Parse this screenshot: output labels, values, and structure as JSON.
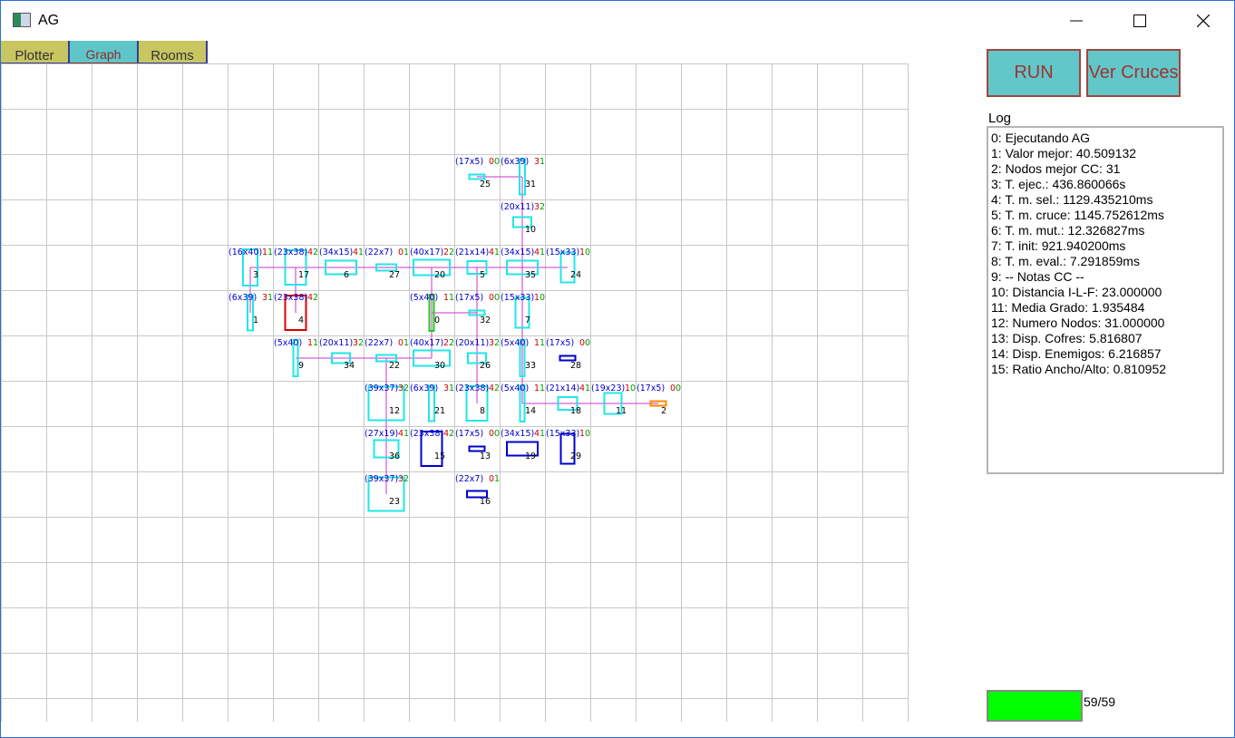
{
  "window": {
    "title": "AG",
    "minimize_icon": "minimize-icon",
    "maximize_icon": "maximize-icon",
    "close_icon": "close-icon"
  },
  "tabs": [
    {
      "label": "Plotter"
    },
    {
      "label": "Graph"
    },
    {
      "label": "Rooms"
    }
  ],
  "active_tab": "Graph",
  "buttons": {
    "run": "RUN",
    "ver_cruces": "Ver Cruces"
  },
  "log": {
    "label": "Log",
    "lines": [
      "0: Ejecutando AG",
      "1: Valor mejor: 40.509132",
      "2: Nodos mejor CC: 31",
      "3: T. ejec.: 436.860066s",
      "4: T. m. sel.: 1129.435210ms",
      "5: T. m. cruce: 1145.752612ms",
      "6: T. m. mut.: 12.326827ms",
      "7: T. init: 921.940200ms",
      "8: T. m. eval.: 7.291859ms",
      "9: -- Notas CC --",
      "10: Distancia I-L-F: 23.000000",
      "11: Media Grado: 1.935484",
      "12: Numero Nodos: 31.000000",
      "13: Disp. Cofres: 5.816807",
      "14: Disp. Enemigos: 6.216857",
      "15: Ratio Ancho/Alto: 0.810952"
    ]
  },
  "progress": {
    "text": "59/59",
    "fraction": 1.0
  },
  "colors": {
    "normal": "#22e6e6",
    "dark": "#0000cc",
    "start": "#22cc22",
    "end": "#ff8800",
    "selected": "#dd0000",
    "edge": "#cc33cc",
    "size_text": "#0000cc",
    "n1": "#cc0000",
    "n2": "#009900"
  },
  "graph": {
    "grid": {
      "cols": 20,
      "rows": 15
    },
    "nodes": [
      {
        "id": "25",
        "size": "(17x5)",
        "a": "0",
        "b": "0",
        "cell": [
          10,
          2
        ],
        "style": "normal"
      },
      {
        "id": "31",
        "size": "(6x39)",
        "a": "3",
        "b": "1",
        "cell": [
          11,
          2
        ],
        "style": "normal"
      },
      {
        "id": "10",
        "size": "(20x11)",
        "a": "3",
        "b": "2",
        "cell": [
          11,
          3
        ],
        "style": "normal"
      },
      {
        "id": "3",
        "size": "(16x40)",
        "a": "1",
        "b": "1",
        "cell": [
          5,
          4
        ],
        "style": "normal"
      },
      {
        "id": "17",
        "size": "(23x38)",
        "a": "4",
        "b": "2",
        "cell": [
          6,
          4
        ],
        "style": "normal"
      },
      {
        "id": "6",
        "size": "(34x15)",
        "a": "4",
        "b": "1",
        "cell": [
          7,
          4
        ],
        "style": "normal"
      },
      {
        "id": "27",
        "size": "(22x7)",
        "a": "0",
        "b": "1",
        "cell": [
          8,
          4
        ],
        "style": "normal"
      },
      {
        "id": "20",
        "size": "(40x17)",
        "a": "2",
        "b": "2",
        "cell": [
          9,
          4
        ],
        "style": "normal"
      },
      {
        "id": "5",
        "size": "(21x14)",
        "a": "4",
        "b": "1",
        "cell": [
          10,
          4
        ],
        "style": "normal"
      },
      {
        "id": "35",
        "size": "(34x15)",
        "a": "4",
        "b": "1",
        "cell": [
          11,
          4
        ],
        "style": "normal"
      },
      {
        "id": "24",
        "size": "(15x33)",
        "a": "1",
        "b": "0",
        "cell": [
          12,
          4
        ],
        "style": "normal"
      },
      {
        "id": "1",
        "size": "(6x39)",
        "a": "3",
        "b": "1",
        "cell": [
          5,
          5
        ],
        "style": "normal"
      },
      {
        "id": "4",
        "size": "(23x38)",
        "a": "4",
        "b": "2",
        "cell": [
          6,
          5
        ],
        "style": "selected"
      },
      {
        "id": "0",
        "size": "(5x40)",
        "a": "1",
        "b": "1",
        "cell": [
          9,
          5
        ],
        "style": "start"
      },
      {
        "id": "32",
        "size": "(17x5)",
        "a": "0",
        "b": "0",
        "cell": [
          10,
          5
        ],
        "style": "normal"
      },
      {
        "id": "7",
        "size": "(15x33)",
        "a": "1",
        "b": "0",
        "cell": [
          11,
          5
        ],
        "style": "normal"
      },
      {
        "id": "9",
        "size": "(5x40)",
        "a": "1",
        "b": "1",
        "cell": [
          6,
          6
        ],
        "style": "normal"
      },
      {
        "id": "34",
        "size": "(20x11)",
        "a": "3",
        "b": "2",
        "cell": [
          7,
          6
        ],
        "style": "normal"
      },
      {
        "id": "22",
        "size": "(22x7)",
        "a": "0",
        "b": "1",
        "cell": [
          8,
          6
        ],
        "style": "normal"
      },
      {
        "id": "30",
        "size": "(40x17)",
        "a": "2",
        "b": "2",
        "cell": [
          9,
          6
        ],
        "style": "normal"
      },
      {
        "id": "26",
        "size": "(20x11)",
        "a": "3",
        "b": "2",
        "cell": [
          10,
          6
        ],
        "style": "normal"
      },
      {
        "id": "33",
        "size": "(5x40)",
        "a": "1",
        "b": "1",
        "cell": [
          11,
          6
        ],
        "style": "normal"
      },
      {
        "id": "28",
        "size": "(17x5)",
        "a": "0",
        "b": "0",
        "cell": [
          12,
          6
        ],
        "style": "dark"
      },
      {
        "id": "12",
        "size": "(39x37)",
        "a": "3",
        "b": "2",
        "cell": [
          8,
          7
        ],
        "style": "normal"
      },
      {
        "id": "21",
        "size": "(6x39)",
        "a": "3",
        "b": "1",
        "cell": [
          9,
          7
        ],
        "style": "normal"
      },
      {
        "id": "8",
        "size": "(23x38)",
        "a": "4",
        "b": "2",
        "cell": [
          10,
          7
        ],
        "style": "normal"
      },
      {
        "id": "14",
        "size": "(5x40)",
        "a": "1",
        "b": "1",
        "cell": [
          11,
          7
        ],
        "style": "normal"
      },
      {
        "id": "18",
        "size": "(21x14)",
        "a": "4",
        "b": "1",
        "cell": [
          12,
          7
        ],
        "style": "normal"
      },
      {
        "id": "11",
        "size": "(19x23)",
        "a": "1",
        "b": "0",
        "cell": [
          13,
          7
        ],
        "style": "normal"
      },
      {
        "id": "2",
        "size": "(17x5)",
        "a": "0",
        "b": "0",
        "cell": [
          14,
          7
        ],
        "style": "end"
      },
      {
        "id": "36",
        "size": "(27x19)",
        "a": "4",
        "b": "1",
        "cell": [
          8,
          8
        ],
        "style": "normal"
      },
      {
        "id": "15",
        "size": "(23x38)",
        "a": "4",
        "b": "2",
        "cell": [
          9,
          8
        ],
        "style": "dark"
      },
      {
        "id": "13",
        "size": "(17x5)",
        "a": "0",
        "b": "0",
        "cell": [
          10,
          8
        ],
        "style": "dark"
      },
      {
        "id": "19",
        "size": "(34x15)",
        "a": "4",
        "b": "1",
        "cell": [
          11,
          8
        ],
        "style": "dark"
      },
      {
        "id": "29",
        "size": "(15x33)",
        "a": "1",
        "b": "0",
        "cell": [
          12,
          8
        ],
        "style": "dark"
      },
      {
        "id": "23",
        "size": "(39x37)",
        "a": "3",
        "b": "2",
        "cell": [
          8,
          9
        ],
        "style": "normal"
      },
      {
        "id": "16",
        "size": "(22x7)",
        "a": "0",
        "b": "1",
        "cell": [
          10,
          9
        ],
        "style": "dark"
      }
    ],
    "edges": [
      [
        "25",
        "31"
      ],
      [
        "31",
        "10"
      ],
      [
        "10",
        "35"
      ],
      [
        "3",
        "24"
      ],
      [
        "3",
        "1"
      ],
      [
        "17",
        "4"
      ],
      [
        "20",
        "30"
      ],
      [
        "5",
        "8"
      ],
      [
        "35",
        "14"
      ],
      [
        "0",
        "32"
      ],
      [
        "9",
        "22"
      ],
      [
        "22",
        "30"
      ],
      [
        "14",
        "2"
      ],
      [
        "36",
        "23"
      ],
      [
        "22",
        "36"
      ],
      [
        "27",
        "20"
      ]
    ]
  }
}
